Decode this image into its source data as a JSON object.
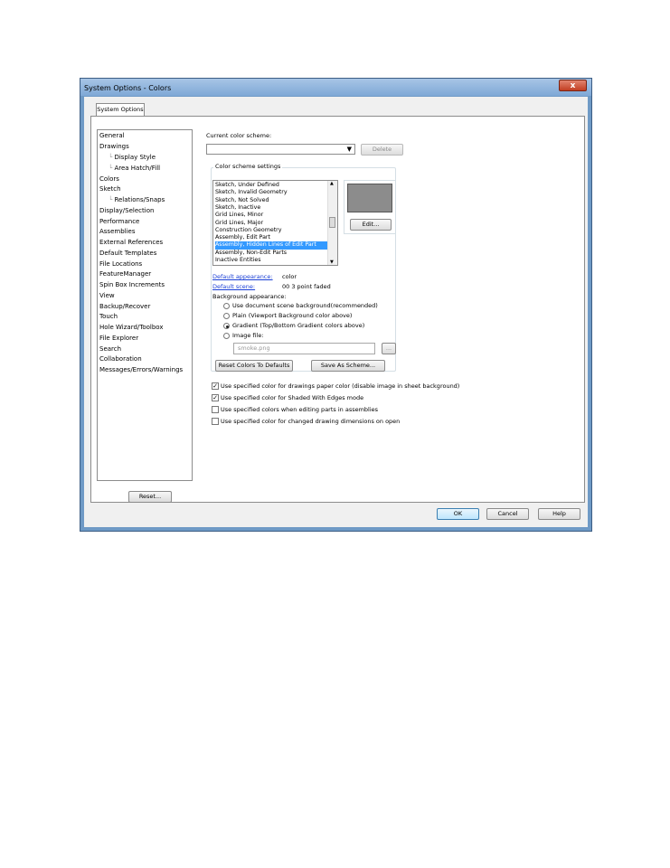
{
  "window": {
    "title": "System Options - Colors",
    "close_glyph": "x"
  },
  "tab": "System Options",
  "tree": [
    "General",
    "Drawings",
    "Display Style",
    "Area Hatch/Fill",
    "Colors",
    "Sketch",
    "Relations/Snaps",
    "Display/Selection",
    "Performance",
    "Assemblies",
    "External References",
    "Default Templates",
    "File Locations",
    "FeatureManager",
    "Spin Box Increments",
    "View",
    "Backup/Recover",
    "Touch",
    "Hole Wizard/Toolbox",
    "File Explorer",
    "Search",
    "Collaboration",
    "Messages/Errors/Warnings"
  ],
  "scheme": {
    "label": "Current color scheme:",
    "value": "",
    "delete_label": "Delete"
  },
  "settings": {
    "group_label": "Color scheme settings",
    "items": [
      "Sketch, Under Defined",
      "Sketch, Invalid Geometry",
      "Sketch, Not Solved",
      "Sketch, Inactive",
      "Grid Lines, Minor",
      "Grid Lines, Major",
      "Construction Geometry",
      "Assembly, Edit Part",
      "Assembly, Hidden Lines of Edit Part",
      "Assembly, Non-Edit Parts",
      "Inactive Entities"
    ],
    "selected_index": 8,
    "edit_label": "Edit...",
    "swatch_color": "#8c8c8c"
  },
  "appearance": {
    "default_appearance_label": "Default appearance:",
    "default_appearance_value": "color",
    "default_scene_label": "Default scene:",
    "default_scene_value": "00 3 point faded",
    "background_label": "Background appearance:",
    "radios": [
      "Use document scene background(recommended)",
      "Plain (Viewport Background color above)",
      "Gradient (Top/Bottom Gradient colors above)",
      "Image file:"
    ],
    "radio_selected": 2,
    "image_file": "smoke.png",
    "browse_label": "...",
    "reset_colors_label": "Reset Colors To Defaults",
    "save_scheme_label": "Save As Scheme..."
  },
  "checkboxes": [
    {
      "label": "Use specified color for drawings paper color (disable image in sheet background)",
      "checked": true
    },
    {
      "label": "Use specified color for Shaded With Edges mode",
      "checked": true
    },
    {
      "label": "Use specified colors when editing parts in assemblies",
      "checked": false
    },
    {
      "label": "Use specified color for changed drawing dimensions on open",
      "checked": false
    }
  ],
  "footer": {
    "reset_label": "Reset...",
    "ok_label": "OK",
    "cancel_label": "Cancel",
    "help_label": "Help"
  },
  "colors": {
    "title_bar": "#7fa8d6",
    "selection": "#3399ff",
    "link": "#1a3fd6"
  }
}
